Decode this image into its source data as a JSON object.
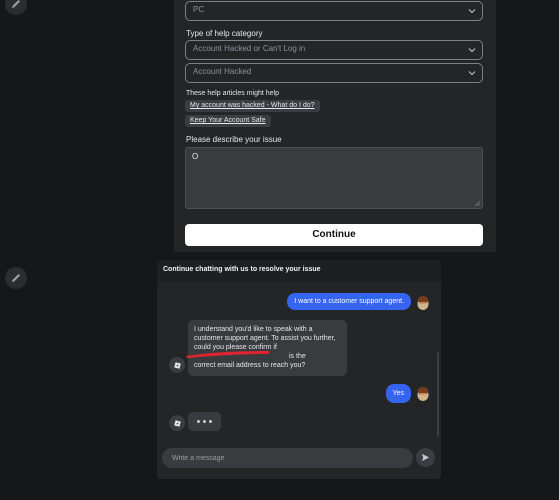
{
  "form": {
    "platform_value": "PC",
    "help_category_label": "Type of help category",
    "help_category_value": "Account Hacked or Can't Log in",
    "help_subcategory_value": "Account Hacked",
    "articles_label": "These help articles might help",
    "articles": [
      "My account was hacked - What do I do?",
      "Keep Your Account Safe"
    ],
    "describe_label": "Please describe your issue",
    "describe_value": "O",
    "continue_label": "Continue"
  },
  "chat": {
    "header": "Continue chatting with us to resolve your issue",
    "messages": [
      {
        "from": "user",
        "text": "I want to a customer support agent."
      },
      {
        "from": "bot",
        "lines": [
          "I understand you'd like to speak with a",
          "customer support agent. To assist you further,",
          "could you please confirm if",
          "is the",
          "correct email address to reach you?"
        ]
      },
      {
        "from": "user",
        "text": "Yes"
      }
    ],
    "input_placeholder": "Write a message"
  },
  "icons": {
    "edit": "pencil-icon",
    "chevron": "chevron-down-icon",
    "bot": "roblox-logo-icon",
    "send": "send-icon"
  },
  "colors": {
    "accent": "#3464f0",
    "redaction": "#e0242f"
  }
}
